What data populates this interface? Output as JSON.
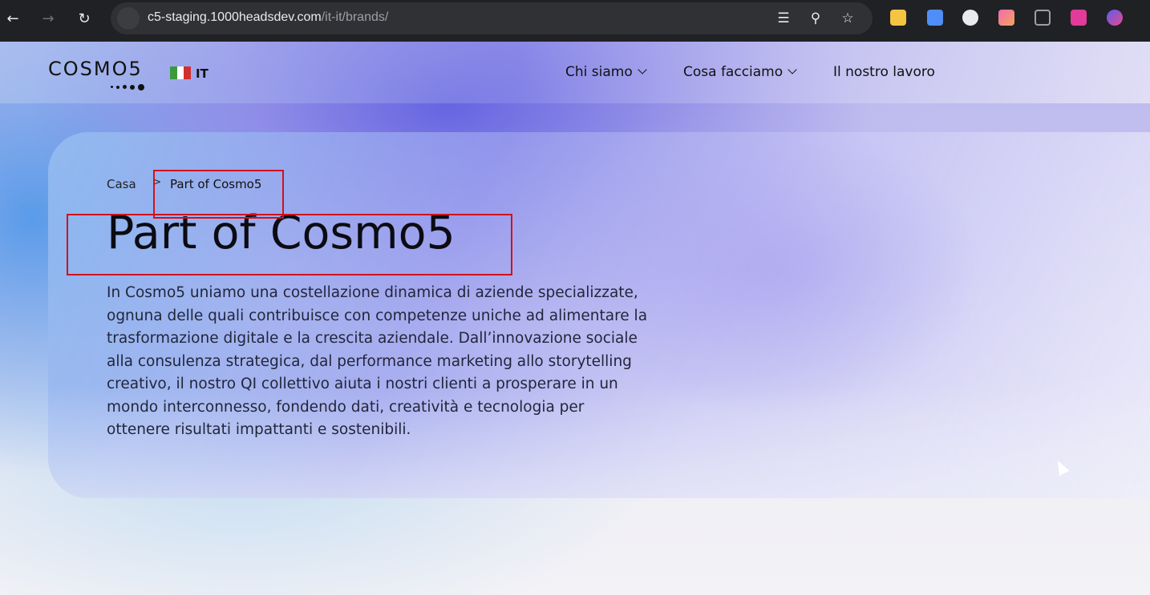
{
  "browser": {
    "url_domain": "c5-staging.1000headsdev.com",
    "url_path": "/it-it/brands/"
  },
  "header": {
    "logo_text": "COSMO5",
    "language_code": "IT",
    "nav": [
      {
        "label": "Chi siamo",
        "has_dropdown": true
      },
      {
        "label": "Cosa facciamo",
        "has_dropdown": true
      },
      {
        "label": "Il nostro lavoro",
        "has_dropdown": false
      }
    ]
  },
  "hero": {
    "breadcrumb": {
      "home": "Casa",
      "separator": ">",
      "current": "Part of Cosmo5"
    },
    "title": "Part of Cosmo5",
    "description": "In Cosmo5 uniamo una costellazione dinamica di aziende specializzate, ognuna delle quali contribuisce con competenze uniche ad alimentare la trasformazione digitale e la crescita aziendale. Dall’innovazione sociale alla consulenza strategica, dal performance marketing allo storytelling creativo, il nostro QI collettivo aiuta i nostri clienti a prosperare in un mondo interconnesso, fondendo dati, creatività e tecnologia per ottenere risultati impattanti e sostenibili."
  },
  "colors": {
    "annotation": "#d0121c",
    "flag_green": "#3c9a3c",
    "flag_white": "#ffffff",
    "flag_red": "#d0312d"
  },
  "icons": {
    "back": "arrow-left-icon",
    "forward": "arrow-right-icon",
    "reload": "reload-icon",
    "site_info": "tune-icon",
    "translate": "translate-icon",
    "zoom": "zoom-icon",
    "bookmark": "star-icon"
  }
}
